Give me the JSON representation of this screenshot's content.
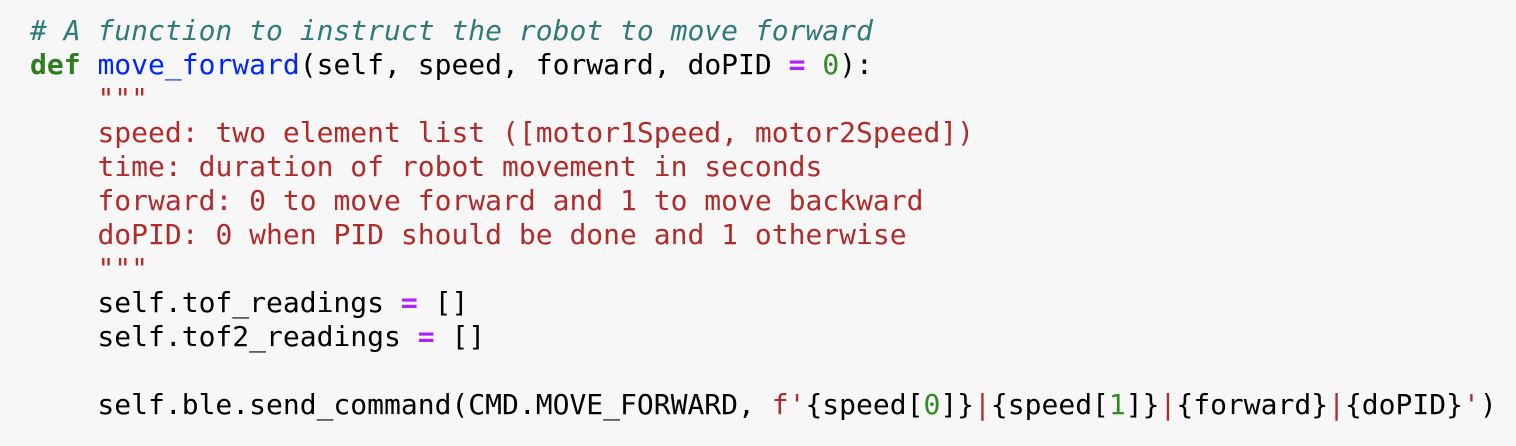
{
  "code": {
    "language": "python",
    "lines": [
      [
        [
          "comment",
          "# A function to instruct the robot to move forward"
        ]
      ],
      [
        [
          "kw",
          "def"
        ],
        [
          "plain",
          " "
        ],
        [
          "fn",
          "move_forward"
        ],
        [
          "plain",
          "(self, speed, forward, doPID "
        ],
        [
          "op",
          "="
        ],
        [
          "plain",
          " "
        ],
        [
          "num",
          "0"
        ],
        [
          "plain",
          "):"
        ]
      ],
      [
        [
          "plain",
          "    "
        ],
        [
          "str",
          "\"\"\""
        ]
      ],
      [
        [
          "plain",
          "    "
        ],
        [
          "str",
          "speed: two element list ([motor1Speed, motor2Speed])"
        ]
      ],
      [
        [
          "plain",
          "    "
        ],
        [
          "str",
          "time: duration of robot movement in seconds"
        ]
      ],
      [
        [
          "plain",
          "    "
        ],
        [
          "str",
          "forward: 0 to move forward and 1 to move backward"
        ]
      ],
      [
        [
          "plain",
          "    "
        ],
        [
          "str",
          "doPID: 0 when PID should be done and 1 otherwise"
        ]
      ],
      [
        [
          "plain",
          "    "
        ],
        [
          "str",
          "\"\"\""
        ]
      ],
      [
        [
          "plain",
          "    self.tof_readings "
        ],
        [
          "op",
          "="
        ],
        [
          "plain",
          " []"
        ]
      ],
      [
        [
          "plain",
          "    self.tof2_readings "
        ],
        [
          "op",
          "="
        ],
        [
          "plain",
          " []"
        ]
      ],
      [],
      [
        [
          "plain",
          "    self.ble.send_command(CMD.MOVE_FORWARD, "
        ],
        [
          "str",
          "f'"
        ],
        [
          "plain",
          "{speed["
        ],
        [
          "num",
          "0"
        ],
        [
          "plain",
          "]}"
        ],
        [
          "str",
          "|"
        ],
        [
          "plain",
          "{speed["
        ],
        [
          "num",
          "1"
        ],
        [
          "plain",
          "]}"
        ],
        [
          "str",
          "|"
        ],
        [
          "plain",
          "{forward}"
        ],
        [
          "str",
          "|"
        ],
        [
          "plain",
          "{doPID}"
        ],
        [
          "str",
          "'"
        ],
        [
          "plain",
          ")"
        ]
      ]
    ]
  }
}
